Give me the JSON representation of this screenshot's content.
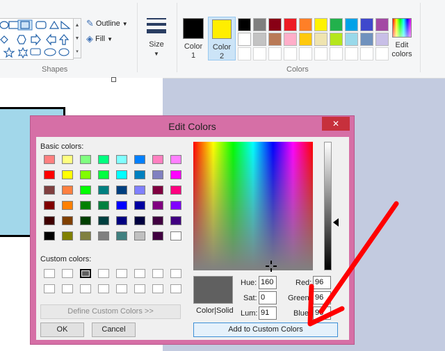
{
  "ribbon": {
    "outline_label": "Outline",
    "fill_label": "Fill",
    "size_label": "Size",
    "color1_line1": "Color",
    "color1_line2": "1",
    "color2_line1": "Color",
    "color2_line2": "2",
    "edit_colors_line1": "Edit",
    "edit_colors_line2": "colors",
    "groups": {
      "shapes": "Shapes",
      "colors": "Colors"
    },
    "color1_value": "#000000",
    "color2_value": "#ffee00",
    "palette_row1": [
      "#000000",
      "#7f7f7f",
      "#880015",
      "#ed1c24",
      "#ff7f27",
      "#fff200",
      "#22b14c",
      "#00a2e8",
      "#3f48cc",
      "#a349a4"
    ],
    "palette_row2": [
      "#ffffff",
      "#c3c3c3",
      "#b97a57",
      "#ffaec9",
      "#ffc90e",
      "#efe4b0",
      "#b5e61d",
      "#99d9ea",
      "#7092be",
      "#c8bfe7"
    ]
  },
  "dialog": {
    "title": "Edit Colors",
    "close_glyph": "✕",
    "basic_colors_label": "Basic colors:",
    "custom_colors_label": "Custom colors:",
    "define_custom_label": "Define Custom Colors >>",
    "ok_label": "OK",
    "cancel_label": "Cancel",
    "add_custom_label": "Add to Custom Colors",
    "color_solid_label": "Color|Solid",
    "hue_label": "Hue:",
    "sat_label": "Sat:",
    "lum_label": "Lum:",
    "red_label": "Red:",
    "green_label": "Green:",
    "blue_label": "Blue:",
    "hue_value": "160",
    "sat_value": "0",
    "lum_value": "91",
    "red_value": "96",
    "green_value": "96",
    "blue_value": "96",
    "preview_color": "#606060",
    "basic_colors": [
      [
        "#ff8080",
        "#ffff80",
        "#80ff80",
        "#00ff80",
        "#80ffff",
        "#0080ff",
        "#ff80c0",
        "#ff80ff"
      ],
      [
        "#ff0000",
        "#ffff00",
        "#80ff00",
        "#00ff40",
        "#00ffff",
        "#0080c0",
        "#8080c0",
        "#ff00ff"
      ],
      [
        "#804040",
        "#ff8040",
        "#00ff00",
        "#008080",
        "#004080",
        "#8080ff",
        "#800040",
        "#ff0080"
      ],
      [
        "#800000",
        "#ff8000",
        "#008000",
        "#008040",
        "#0000ff",
        "#0000a0",
        "#800080",
        "#8000ff"
      ],
      [
        "#400000",
        "#804000",
        "#004000",
        "#004040",
        "#000080",
        "#000040",
        "#400040",
        "#400080"
      ],
      [
        "#000000",
        "#808000",
        "#808040",
        "#808080",
        "#408080",
        "#c0c0c0",
        "#400040",
        "#ffffff"
      ]
    ],
    "custom_colors": [
      [
        "#ffffff",
        "#ffffff",
        "#606060",
        "#ffffff",
        "#ffffff",
        "#ffffff",
        "#ffffff",
        "#ffffff"
      ],
      [
        "#ffffff",
        "#ffffff",
        "#ffffff",
        "#ffffff",
        "#ffffff",
        "#ffffff",
        "#ffffff",
        "#ffffff"
      ]
    ],
    "selected_custom": {
      "row": 0,
      "col": 2
    }
  },
  "annotation": {
    "arrow_color": "#ff0000"
  }
}
